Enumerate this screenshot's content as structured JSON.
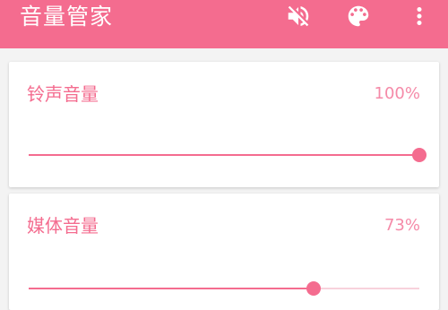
{
  "app": {
    "title": "音量管家"
  },
  "toolbar": {
    "icons": [
      "mute-icon",
      "palette-icon",
      "more-vert-icon"
    ]
  },
  "colors": {
    "accent": "#f46c8f",
    "accent_light": "#f58aa8",
    "track": "#f8d2dc",
    "background": "#f3f3f3"
  },
  "volumes": [
    {
      "label": "铃声音量",
      "percent_text": "100%",
      "level": 1.0
    },
    {
      "label": "媒体音量",
      "percent_text": "73%",
      "level": 0.73
    }
  ]
}
